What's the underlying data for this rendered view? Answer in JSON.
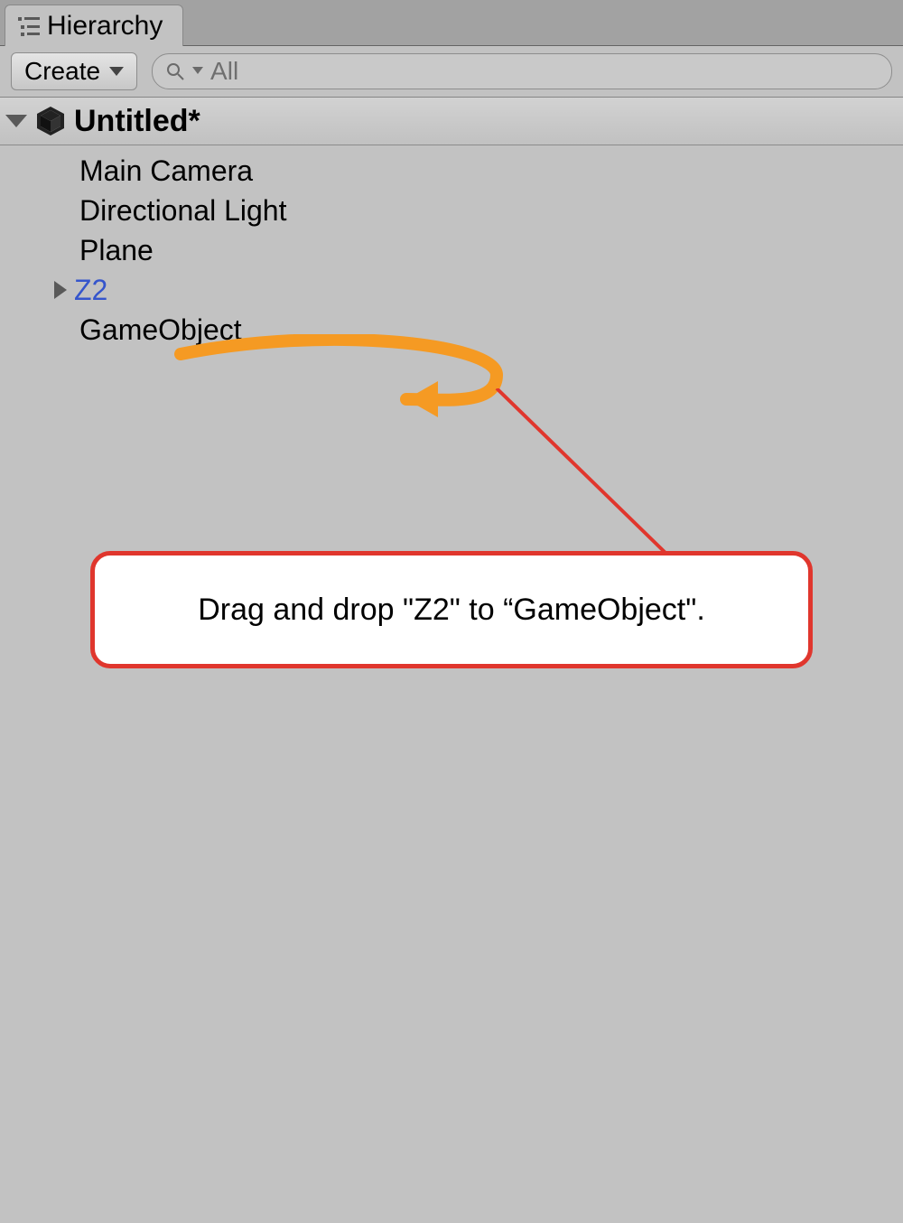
{
  "tab": {
    "label": "Hierarchy"
  },
  "toolbar": {
    "create_label": "Create",
    "search_placeholder": "All"
  },
  "scene": {
    "title": "Untitled*"
  },
  "items": [
    {
      "label": "Main Camera",
      "prefab": false,
      "expandable": false
    },
    {
      "label": "Directional Light",
      "prefab": false,
      "expandable": false
    },
    {
      "label": "Plane",
      "prefab": false,
      "expandable": false
    },
    {
      "label": "Z2",
      "prefab": true,
      "expandable": true
    },
    {
      "label": "GameObject",
      "prefab": false,
      "expandable": false
    }
  ],
  "annotation": {
    "text": "Drag and drop \"Z2\" to “GameObject\"."
  }
}
